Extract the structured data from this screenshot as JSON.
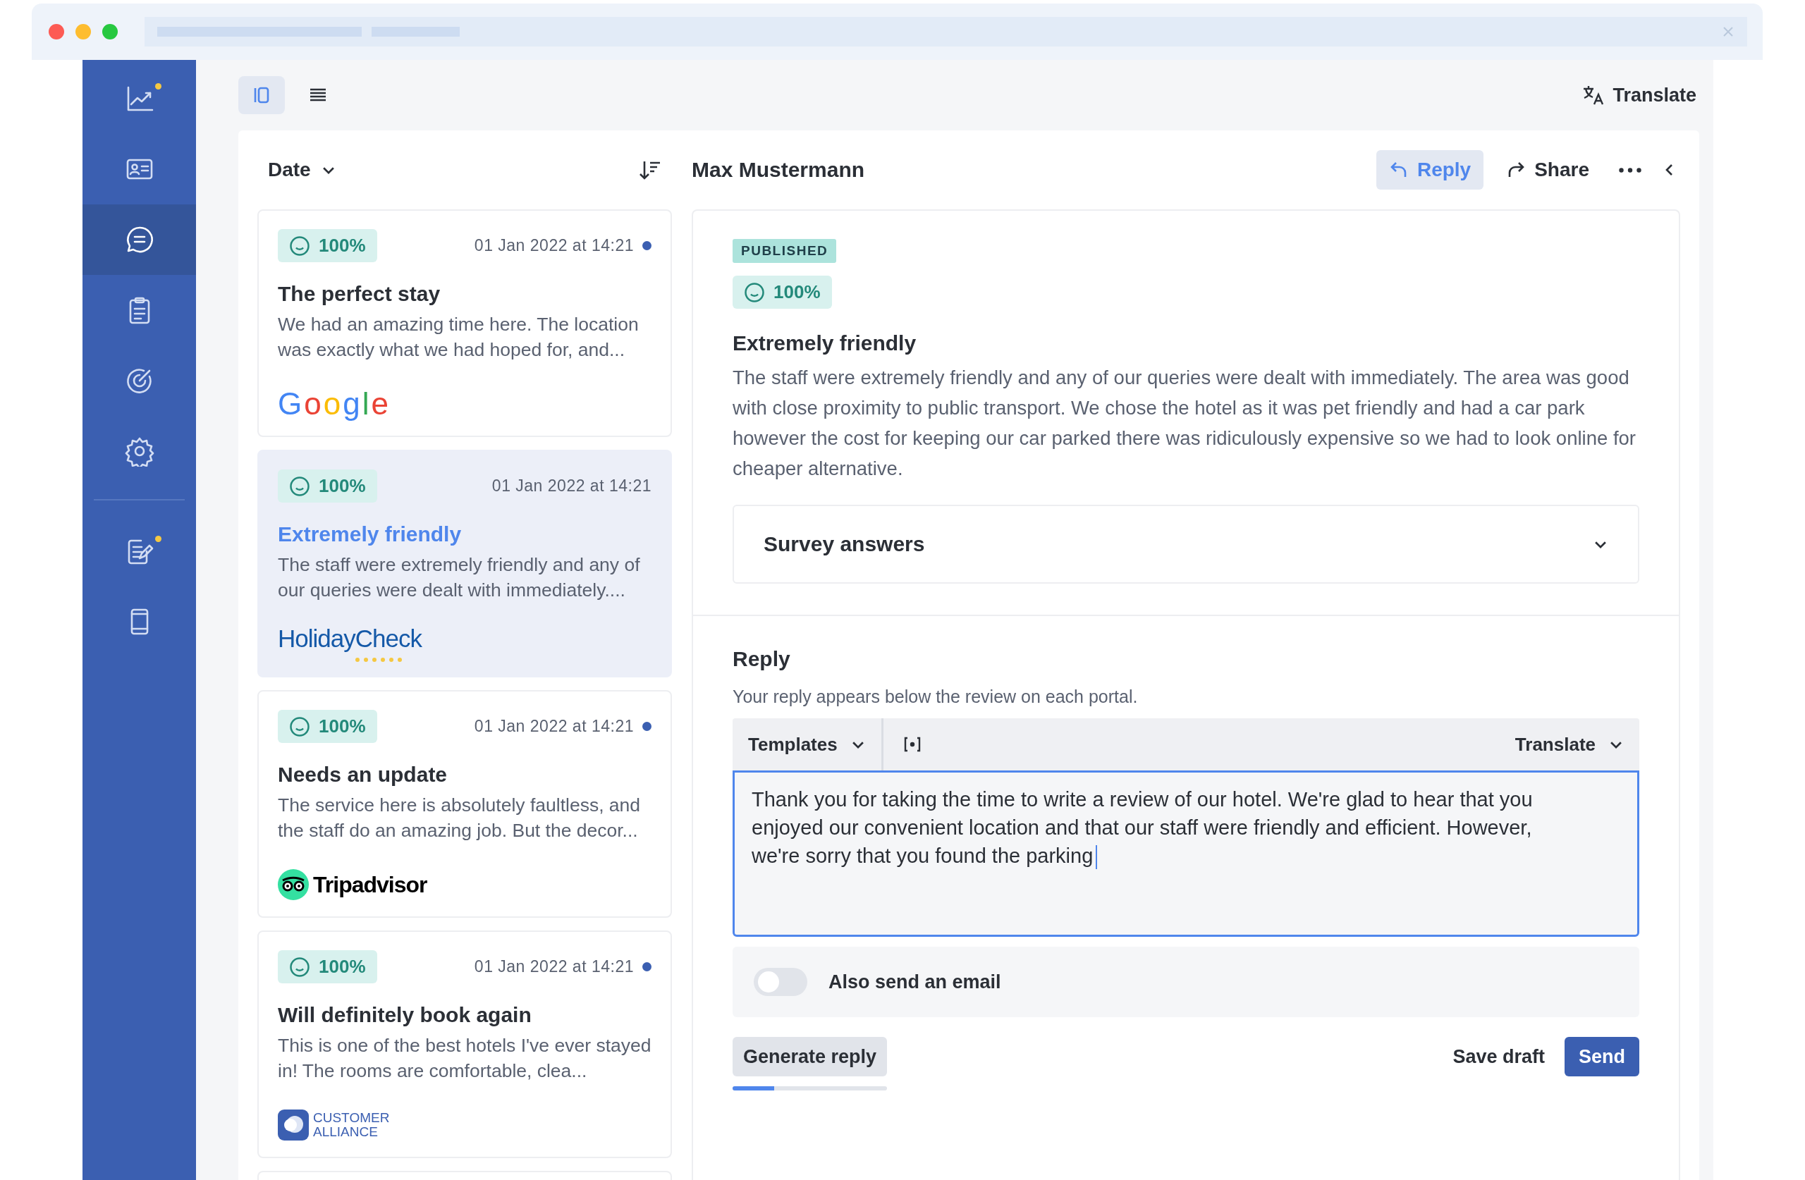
{
  "sidebar": {
    "items": [
      {
        "kind": "chart",
        "selected": false,
        "dot": true
      },
      {
        "kind": "card",
        "selected": false,
        "dot": false
      },
      {
        "kind": "chat",
        "selected": true,
        "dot": false
      },
      {
        "kind": "clipboard",
        "selected": false,
        "dot": false
      },
      {
        "kind": "target",
        "selected": false,
        "dot": false
      },
      {
        "kind": "gear",
        "selected": false,
        "dot": false
      }
    ],
    "bottom_items": [
      {
        "kind": "note",
        "selected": false,
        "dot": true
      },
      {
        "kind": "phone",
        "selected": false,
        "dot": false
      }
    ]
  },
  "toolbar": {
    "view_modes": [
      {
        "kind": "columns",
        "selected": true
      },
      {
        "kind": "list",
        "selected": false
      }
    ],
    "translate": "Translate"
  },
  "list": {
    "sort_label": "Date",
    "reviews": [
      {
        "score": "100%",
        "date": "01 Jan 2022 at 14:21",
        "unread": true,
        "selected": false,
        "title": "The perfect stay",
        "excerpt": "We had an amazing time here. The location was exactly what we had hoped for, and...",
        "source": {
          "kind": "google",
          "name": "Google"
        }
      },
      {
        "score": "100%",
        "date": "01 Jan 2022 at 14:21",
        "unread": false,
        "selected": true,
        "title": "Extremely friendly",
        "excerpt": "The staff were extremely friendly and any of our queries were dealt with immediately....",
        "source": {
          "kind": "holidaycheck",
          "name": "HolidayCheck"
        }
      },
      {
        "score": "100%",
        "date": "01 Jan 2022 at 14:21",
        "unread": true,
        "selected": false,
        "title": "Needs an update",
        "excerpt": "The service here is absolutely faultless, and the staff do an amazing job. But the decor...",
        "source": {
          "kind": "tripadvisor",
          "name": "Tripadvisor"
        }
      },
      {
        "score": "100%",
        "date": "01 Jan 2022 at 14:21",
        "unread": true,
        "selected": false,
        "title": "Will definitely book again",
        "excerpt": "This is one of the best hotels I've ever stayed in! The rooms are comfortable, clea...",
        "source": {
          "kind": "customeralliance",
          "name": "CUSTOMER ALLIANCE"
        }
      }
    ]
  },
  "detail": {
    "author": "Max Mustermann",
    "actions": [
      {
        "kind": "reply",
        "label": "Reply",
        "selected": true
      },
      {
        "kind": "share",
        "label": "Share",
        "selected": false
      }
    ],
    "status": "PUBLISHED",
    "score": "100%",
    "title": "Extremely friendly",
    "body": "The staff were extremely friendly and any of our queries were dealt with immediately. The area was good with close proximity to public transport. We chose the hotel as it was pet friendly and had a car park however the cost for keeping our car parked there was ridiculously expensive so we had to look online for cheaper alternative.",
    "survey": {
      "label": "Survey answers",
      "expanded": false
    }
  },
  "reply": {
    "heading": "Reply",
    "hint": "Your reply appears below the review on each portal.",
    "templates": "Templates",
    "translate": "Translate",
    "value": "Thank you for taking the time to write a review of our hotel. We're glad to hear that you enjoyed our convenient location and that our staff were friendly and efficient. However, we're sorry that you found the parking",
    "email": {
      "label": "Also send an email",
      "on": false
    },
    "generate": "Generate reply",
    "progress": {
      "level": 0.27
    },
    "save": "Save draft",
    "send": "Send"
  }
}
